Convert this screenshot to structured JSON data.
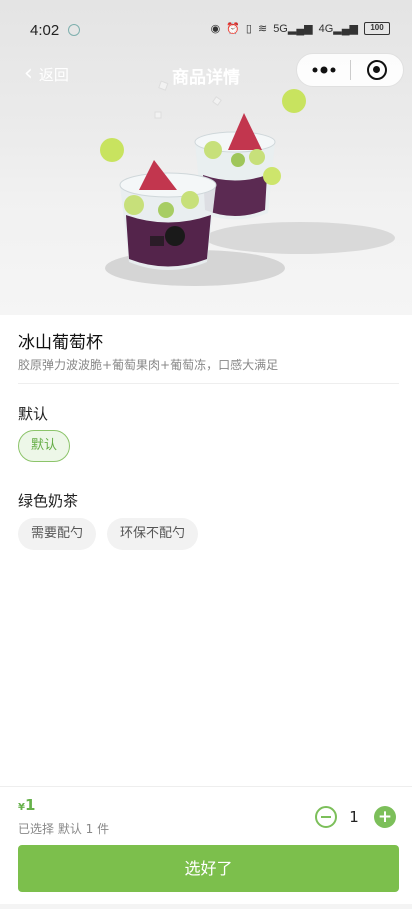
{
  "status_bar": {
    "time": "4:02",
    "signal_label_1": "5G",
    "signal_label_2": "4G",
    "battery": "100"
  },
  "nav": {
    "back_label": "返回",
    "title": "商品详情"
  },
  "product": {
    "name": "冰山葡萄杯",
    "description": "胶原弹力波波脆+葡萄果肉+葡萄冻，口感大满足"
  },
  "options": [
    {
      "title": "默认",
      "choices": [
        {
          "label": "默认",
          "selected": true
        }
      ]
    },
    {
      "title": "绿色奶茶",
      "choices": [
        {
          "label": "需要配勺",
          "selected": false
        },
        {
          "label": "环保不配勺",
          "selected": false
        }
      ]
    }
  ],
  "bottom": {
    "currency": "¥",
    "price": "1",
    "selected_summary": "已选择 默认 1 件",
    "quantity": "1",
    "confirm_label": "选好了"
  },
  "colors": {
    "accent": "#7cbf4c",
    "price": "#66b14a"
  }
}
